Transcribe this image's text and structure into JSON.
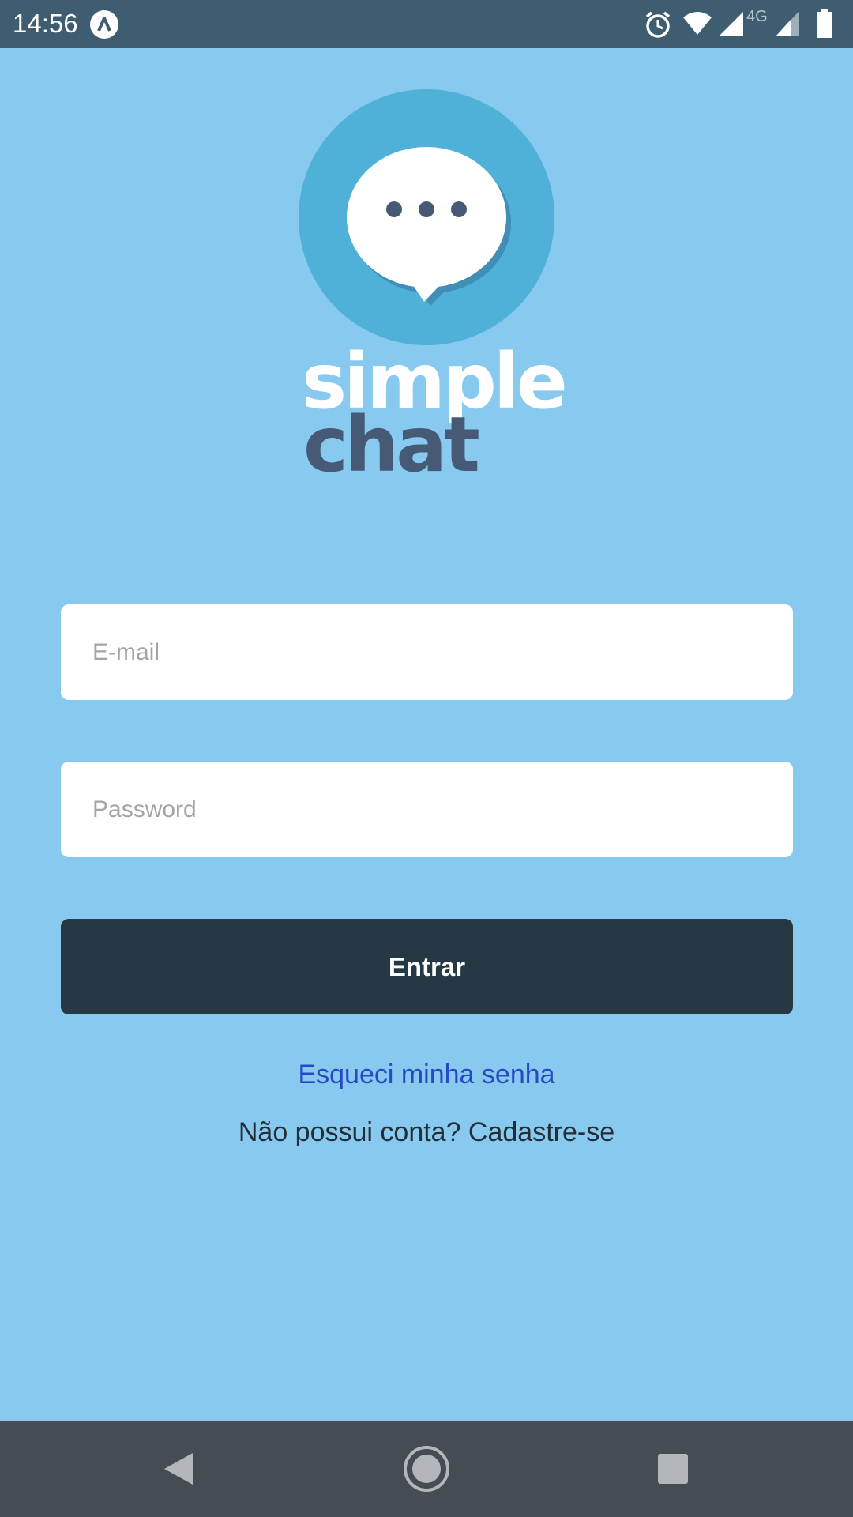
{
  "status_bar": {
    "time": "14:56",
    "app_icon": "arrow-up-icon",
    "icons": [
      "alarm-icon",
      "wifi-icon",
      "signal-icon",
      "4g-signal-icon",
      "battery-icon"
    ],
    "network_label": "4G"
  },
  "logo": {
    "icon": "chat-bubble-icon",
    "word_1": "simple",
    "word_2": "chat"
  },
  "form": {
    "email_placeholder": "E-mail",
    "email_value": "",
    "password_placeholder": "Password",
    "password_value": "",
    "submit_label": "Entrar"
  },
  "links": {
    "forgot_password": "Esqueci minha senha",
    "signup": "Não possui conta? Cadastre-se"
  },
  "nav_bar": {
    "icons": [
      "back-icon",
      "home-icon",
      "recent-apps-icon"
    ]
  },
  "colors": {
    "background": "#88c9ef",
    "status_bar": "#3f5d70",
    "button": "#263843",
    "link": "#2948c7",
    "logo_circle": "#4fb1d7",
    "logo_dark_text": "#465a76",
    "nav_bar": "#464c53"
  }
}
